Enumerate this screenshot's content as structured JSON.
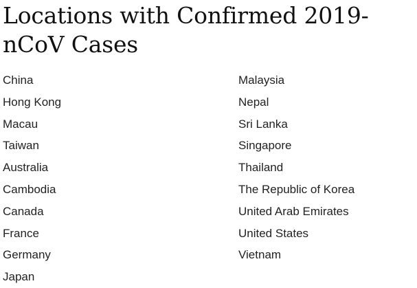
{
  "title": "Locations with Confirmed 2019-nCoV Cases",
  "locations": {
    "left": [
      "China",
      "Hong Kong",
      "Macau",
      "Taiwan",
      "Australia",
      "Cambodia",
      "Canada",
      "France",
      "Germany",
      "Japan"
    ],
    "right": [
      "Malaysia",
      "Nepal",
      "Sri Lanka",
      "Singapore",
      "Thailand",
      "The Republic of Korea",
      "United Arab Emirates",
      "United States",
      "Vietnam"
    ]
  }
}
